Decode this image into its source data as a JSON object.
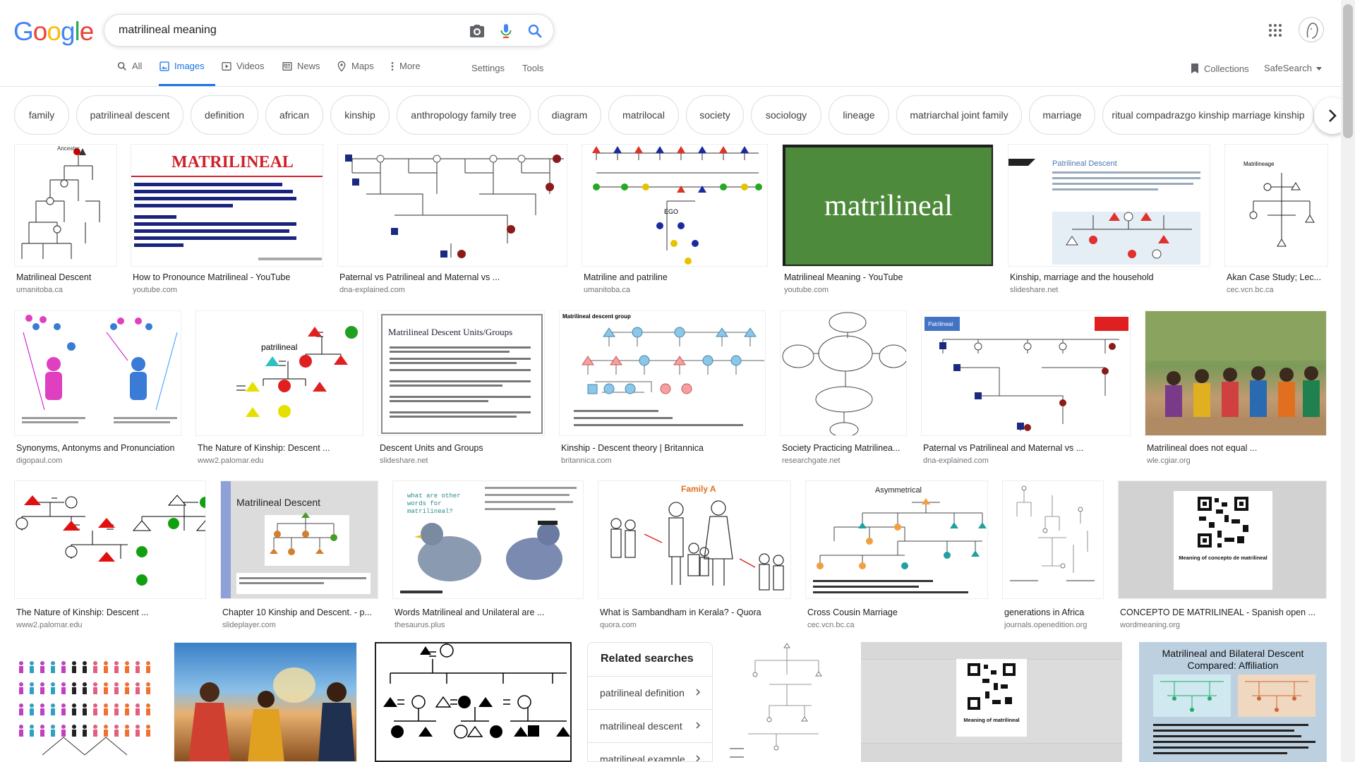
{
  "logo": {
    "letters": [
      "G",
      "o",
      "o",
      "g",
      "l",
      "e"
    ],
    "colors": [
      "#4285F4",
      "#EA4335",
      "#FBBC05",
      "#4285F4",
      "#34A853",
      "#EA4335"
    ]
  },
  "search": {
    "query": "matrilineal meaning",
    "icons": [
      "camera-icon",
      "mic-icon",
      "search-icon"
    ]
  },
  "tabs": [
    {
      "label": "All",
      "icon": "search-icon"
    },
    {
      "label": "Images",
      "icon": "image-icon",
      "active": true
    },
    {
      "label": "Videos",
      "icon": "play-icon"
    },
    {
      "label": "News",
      "icon": "news-icon"
    },
    {
      "label": "Maps",
      "icon": "map-icon"
    },
    {
      "label": "More",
      "icon": "more-icon"
    }
  ],
  "nav_extra": {
    "settings": "Settings",
    "tools": "Tools",
    "collections": "Collections",
    "safesearch": "SafeSearch"
  },
  "chips": [
    "family",
    "patrilineal descent",
    "definition",
    "african",
    "kinship",
    "anthropology family tree",
    "diagram",
    "matrilocal",
    "society",
    "sociology",
    "lineage",
    "matriarchal joint family",
    "marriage",
    "ritual compadrazgo kinship marriage kinship"
  ],
  "results": [
    {
      "title": "Matrilineal Descent",
      "source": "umanitoba.ca",
      "img_text": "Ancestor"
    },
    {
      "title": "How to Pronounce Matrilineal - YouTube",
      "source": "youtube.com",
      "img_text": "MATRILINEAL"
    },
    {
      "title": "Paternal vs Patrilineal and Maternal vs ...",
      "source": "dna-explained.com",
      "img_text": ""
    },
    {
      "title": "Matriline and patriline",
      "source": "umanitoba.ca",
      "img_text": "EGO"
    },
    {
      "title": "Matrilineal Meaning - YouTube",
      "source": "youtube.com",
      "img_text": "matrilineal"
    },
    {
      "title": "Kinship, marriage and the household",
      "source": "slideshare.net",
      "img_text": "Patrilineal Descent"
    },
    {
      "title": "Akan Case Study; Lec...",
      "source": "cec.vcn.bc.ca",
      "img_text": "Matrilineage"
    },
    {
      "title": "Synonyms, Antonyms and Pronunciation",
      "source": "digopaul.com",
      "img_text": ""
    },
    {
      "title": "The Nature of Kinship: Descent ...",
      "source": "www2.palomar.edu",
      "img_text": "patrilineal"
    },
    {
      "title": "Descent Units and Groups",
      "source": "slideshare.net",
      "img_text": "Matrilineal Descent Units/Groups"
    },
    {
      "title": "Kinship - Descent theory | Britannica",
      "source": "britannica.com",
      "img_text": "Matrilineal descent group"
    },
    {
      "title": "Society Practicing Matrilinea...",
      "source": "researchgate.net",
      "img_text": ""
    },
    {
      "title": "Paternal vs Patrilineal and Maternal vs ...",
      "source": "dna-explained.com",
      "img_text": "Patrilineal"
    },
    {
      "title": "Matrilineal does not equal ...",
      "source": "wle.cgiar.org",
      "img_text": ""
    },
    {
      "title": "The Nature of Kinship: Descent ...",
      "source": "www2.palomar.edu",
      "img_text": ""
    },
    {
      "title": "Chapter 10 Kinship and Descent. - p...",
      "source": "slideplayer.com",
      "img_text": "Matrilineal Descent"
    },
    {
      "title": "Words Matrilineal and Unilateral are ...",
      "source": "thesaurus.plus",
      "img_text": "what are other words for matrilineal?"
    },
    {
      "title": "What is Sambandham in Kerala? - Quora",
      "source": "quora.com",
      "img_text": "Family A"
    },
    {
      "title": "Cross Cousin Marriage",
      "source": "cec.vcn.bc.ca",
      "img_text": "Asymmetrical"
    },
    {
      "title": "generations in Africa",
      "source": "journals.openedition.org",
      "img_text": ""
    },
    {
      "title": "CONCEPTO DE MATRILINEAL - Spanish open ...",
      "source": "wordmeaning.org",
      "img_text": "Meaning of concepto de matrilineal"
    },
    {
      "title": "",
      "source": "",
      "img_text": ""
    },
    {
      "title": "",
      "source": "",
      "img_text": ""
    },
    {
      "title": "",
      "source": "",
      "img_text": ""
    },
    {
      "title": "",
      "source": "",
      "img_text": ""
    },
    {
      "title": "",
      "source": "",
      "img_text": "Meaning of matrilineal"
    },
    {
      "title": "",
      "source": "",
      "img_text": "Matrilineal and Bilateral Descent Compared: Affiliation"
    }
  ],
  "related": {
    "heading": "Related searches",
    "items": [
      "patrilineal definition",
      "matrilineal descent",
      "matrilineal example"
    ]
  },
  "accent": "#1a73e8"
}
